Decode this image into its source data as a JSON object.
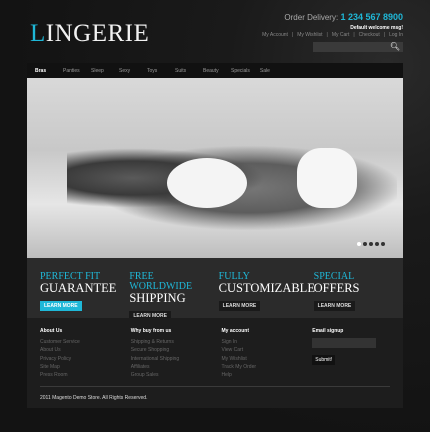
{
  "header": {
    "logo_first": "L",
    "logo_rest": "INGERIE",
    "delivery_label": "Order Delivery:",
    "phone": "1 234 567 8900",
    "welcome": "Default welcome msg!",
    "links": [
      "My Account",
      "|",
      "My Wishlist",
      "|",
      "My Cart",
      "|",
      "Checkout",
      "|",
      "Log In"
    ],
    "search_icon": "magnifier-icon"
  },
  "nav": [
    "Bras",
    "Panties",
    "Sleep",
    "Sexy",
    "Toys",
    "Suits",
    "Beauty",
    "Specials",
    "Sale"
  ],
  "slider": {
    "dots": 5,
    "active": 1
  },
  "promos": [
    {
      "t1": "PERFECT FIT",
      "t2": "GUARANTEE",
      "btn": "LEARN MORE"
    },
    {
      "t1": "FREE WORLDWIDE",
      "t2": "SHIPPING",
      "btn": "LEARN MORE"
    },
    {
      "t1": "FULLY",
      "t2": "CUSTOMIZABLE",
      "btn": "LEARN MORE"
    },
    {
      "t1": "SPECIAL",
      "t2": "OFFERS",
      "btn": "LEARN MORE"
    }
  ],
  "footer": {
    "cols": [
      {
        "title": "About Us",
        "items": [
          "Customer Service",
          "About Us",
          "Privacy Policy",
          "Site Map",
          "Press Room"
        ]
      },
      {
        "title": "Why buy from us",
        "items": [
          "Shipping & Returns",
          "Secure Shopping",
          "International Shipping",
          "Affiliates",
          "Group Sales"
        ]
      },
      {
        "title": "My account",
        "items": [
          "Sign In",
          "View Cart",
          "My Wishlist",
          "Track My Order",
          "Help"
        ]
      }
    ],
    "email_title": "Email signup",
    "submit": "Submit!",
    "copyright": "2011 Magento Demo Store. All Rights Reserved."
  },
  "colors": {
    "accent": "#1fb8d8"
  }
}
